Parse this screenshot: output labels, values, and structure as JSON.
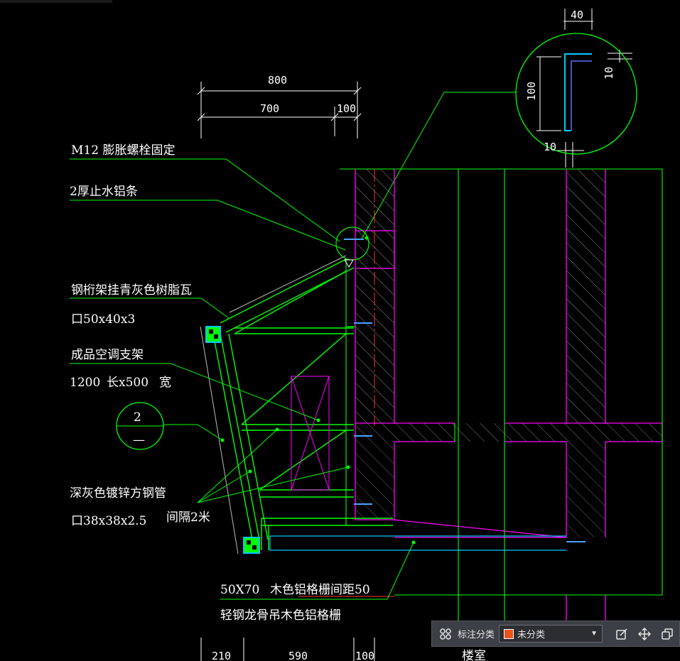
{
  "dimensions": {
    "d800": "800",
    "d700": "700",
    "d100_top": "100",
    "d40": "40",
    "d100_detail": "100",
    "d10_right": "10",
    "d10_bottom": "10",
    "d210": "210",
    "d590": "590",
    "d100_bottom": "100"
  },
  "labels": {
    "bolt": "M12 膨胀螺栓固定",
    "waterstop": "2厚止水铝条",
    "truss": "钢桁架挂青灰色树脂瓦",
    "truss_size": "口50x40x3",
    "ac_bracket": "成品空调支架",
    "ac_size_len": "1200",
    "ac_size_len_unit": "长x500",
    "ac_size_width": "宽",
    "steel_tube": "深灰色镀锌方钢管",
    "steel_tube_size": "口38x38x2.5",
    "interval": "间隔2米",
    "grille_size": "50X70",
    "grille_desc": "木色铝格栅间距50",
    "grille_keel": "轻钢龙骨吊木色铝格栅",
    "section_num": "2",
    "section_sub": "—",
    "cut_text": "楼室"
  },
  "toolbar": {
    "category_label": "标注分类",
    "selected": "未分类",
    "swatch_color": "#e8541a"
  },
  "colors": {
    "green": "#00ff00",
    "magenta": "#ff00ff",
    "white": "#ffffff",
    "cyan": "#00c8ff",
    "red": "#ff3030"
  }
}
